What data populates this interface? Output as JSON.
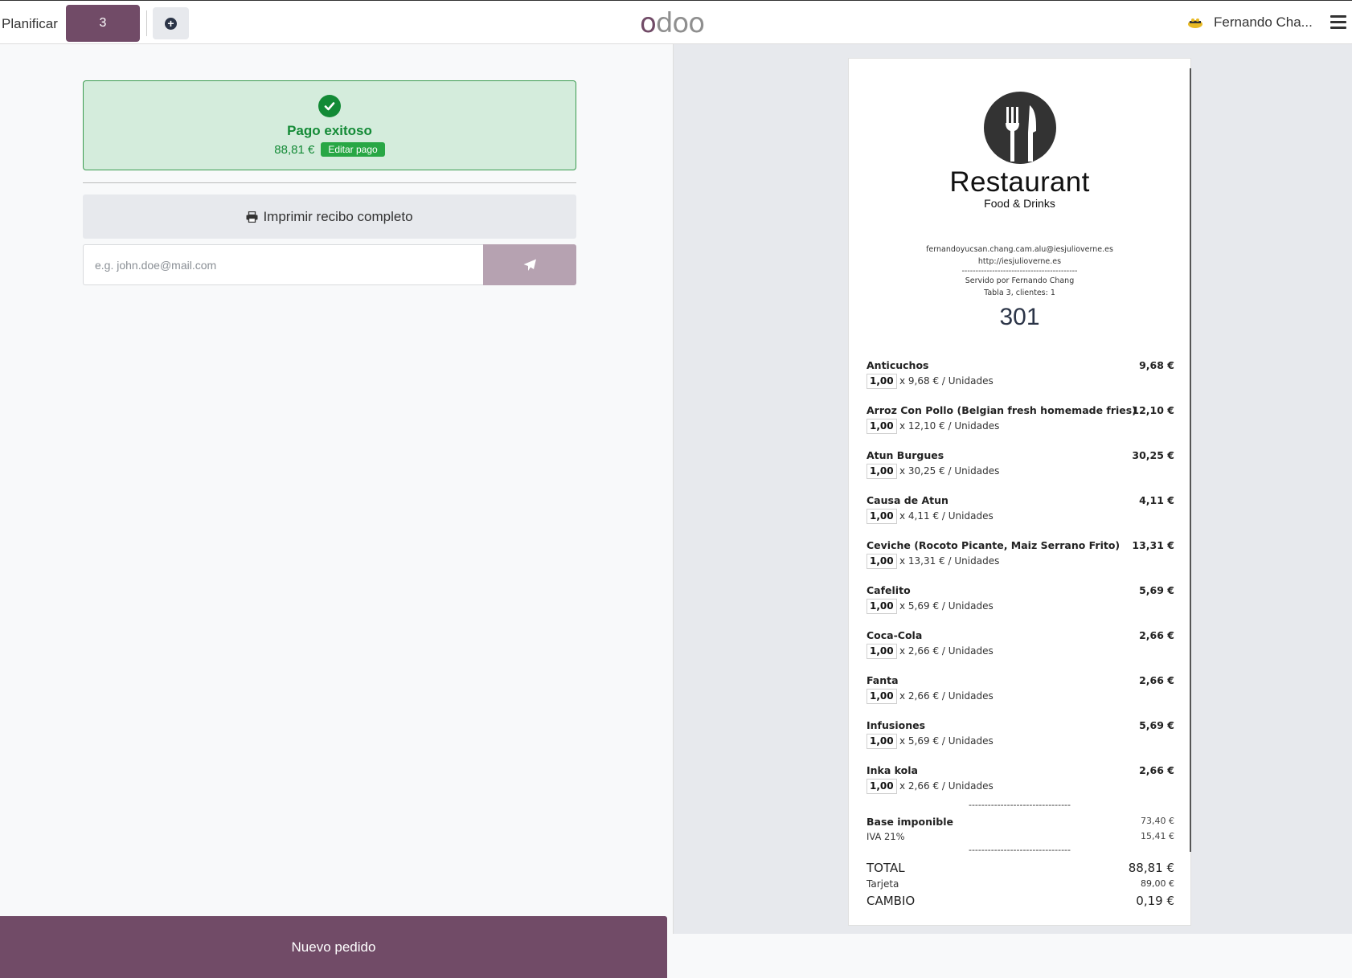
{
  "topbar": {
    "plan_label": "Planificar",
    "table_number": "3",
    "logo": "odoo",
    "user_name": "Fernando Cha..."
  },
  "payment": {
    "status": "Pago exitoso",
    "amount": "88,81 €",
    "edit_label": "Editar pago",
    "print_label": "Imprimir recibo completo",
    "email_placeholder": "e.g. john.doe@mail.com",
    "new_order_label": "Nuevo pedido"
  },
  "receipt": {
    "logo_name": "Restaurant",
    "logo_sub": "Food & Drinks",
    "email": "fernandoyucsan.chang.cam.alu@iesjulioverne.es",
    "website": "http://iesjulioverne.es",
    "separator": "------------------------------------------",
    "served_by": "Servido por Fernando Chang",
    "table_info": "Tabla 3, clientes: 1",
    "order_number": "301",
    "lines": [
      {
        "name": "Anticuchos",
        "qty": "1,00",
        "detail": "x 9,68 € / Unidades",
        "price": "9,68 €"
      },
      {
        "name": "Arroz Con Pollo (Belgian fresh homemade fries)",
        "qty": "1,00",
        "detail": "x 12,10 € / Unidades",
        "price": "12,10 €"
      },
      {
        "name": "Atun Burgues",
        "qty": "1,00",
        "detail": "x 30,25 € / Unidades",
        "price": "30,25 €"
      },
      {
        "name": "Causa de Atun",
        "qty": "1,00",
        "detail": "x 4,11 € / Unidades",
        "price": "4,11 €"
      },
      {
        "name": "Ceviche (Rocoto Picante, Maiz Serrano Frito)",
        "qty": "1,00",
        "detail": "x 13,31 € / Unidades",
        "price": "13,31 €"
      },
      {
        "name": "Cafelito",
        "qty": "1,00",
        "detail": "x 5,69 € / Unidades",
        "price": "5,69 €"
      },
      {
        "name": "Coca-Cola",
        "qty": "1,00",
        "detail": "x 2,66 € / Unidades",
        "price": "2,66 €"
      },
      {
        "name": "Fanta",
        "qty": "1,00",
        "detail": "x 2,66 € / Unidades",
        "price": "2,66 €"
      },
      {
        "name": "Infusiones",
        "qty": "1,00",
        "detail": "x 5,69 € / Unidades",
        "price": "5,69 €"
      },
      {
        "name": "Inka kola",
        "qty": "1,00",
        "detail": "x 2,66 € / Unidades",
        "price": "2,66 €"
      }
    ],
    "dash_line": "--------------------------------",
    "base_label": "Base imponible",
    "base_value": "73,40 €",
    "iva_label": "IVA 21%",
    "iva_value": "15,41 €",
    "total_label": "TOTAL",
    "total_value": "88,81 €",
    "tarjeta_label": "Tarjeta",
    "tarjeta_value": "89,00 €",
    "cambio_label": "CAMBIO",
    "cambio_value": "0,19 €"
  }
}
